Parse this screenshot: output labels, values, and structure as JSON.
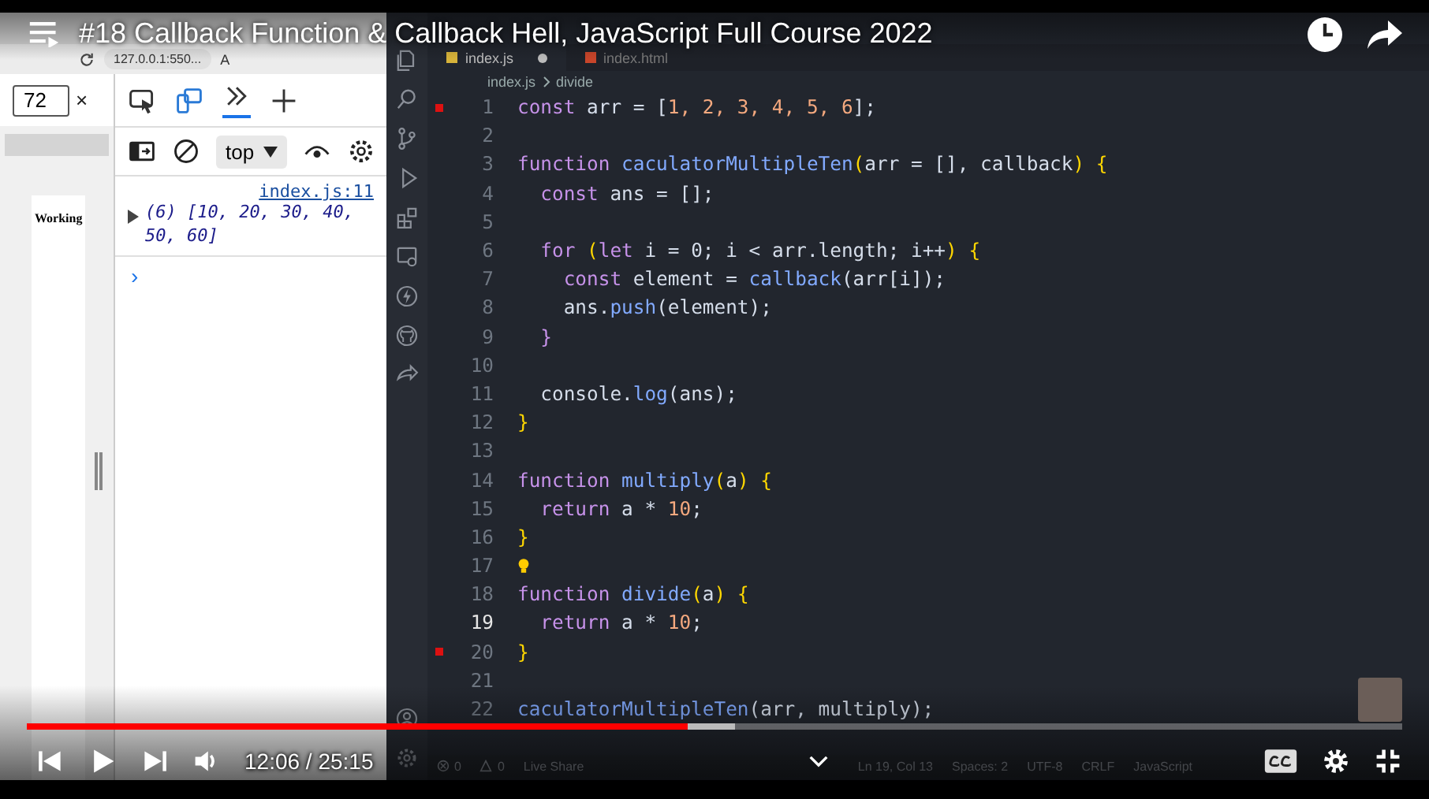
{
  "video": {
    "title": "#18 Callback Function & Callback Hell, JavaScript Full Course 2022",
    "time": "12:06 / 25:15",
    "progress": {
      "level": 0.48
    },
    "buffered": {
      "level": 0.515
    }
  },
  "browser": {
    "address": "127.0.0.1:550...",
    "reader": "A",
    "zoom_field": {
      "value": "72"
    },
    "close": "×",
    "page_text": "Working",
    "console": {
      "context": "top",
      "source": "index.js:11",
      "output": "(6) [10, 20, 30, 40, 50, 60]",
      "prompt": "›"
    }
  },
  "editor": {
    "tabs": [
      {
        "label": "index.js",
        "selected": true,
        "modified": true
      },
      {
        "label": "index.html",
        "selected": false,
        "modified": false
      }
    ],
    "breadcrumb": [
      "index.js",
      "divide"
    ],
    "lines": [
      {
        "number": "1",
        "breakpoint": true,
        "current": false,
        "hint": false,
        "tokens": [
          {
            "kind": "keyword",
            "text": "const"
          },
          {
            "kind": "variable",
            "text": " arr = ["
          },
          {
            "kind": "number",
            "text": "1, 2, 3, 4, 5, 6"
          },
          {
            "kind": "punct",
            "text": "];"
          }
        ]
      },
      {
        "number": "2",
        "breakpoint": false,
        "current": false,
        "hint": false
      },
      {
        "number": "3",
        "breakpoint": false,
        "current": false,
        "hint": false,
        "tokens": [
          {
            "kind": "keyword",
            "text": "function"
          },
          {
            "kind": "function",
            "text": " caculatorMultipleTen"
          },
          {
            "kind": "bracket",
            "text": "("
          },
          {
            "kind": "variable",
            "text": "arr = [], callback"
          },
          {
            "kind": "bracket",
            "text": ") {"
          }
        ]
      },
      {
        "number": "4",
        "breakpoint": false,
        "current": false,
        "hint": false,
        "tokens": [
          {
            "kind": "keyword",
            "text": "  const"
          },
          {
            "kind": "variable",
            "text": " ans = [];"
          }
        ]
      },
      {
        "number": "5",
        "breakpoint": false,
        "current": false,
        "hint": false
      },
      {
        "number": "6",
        "breakpoint": false,
        "current": false,
        "hint": false,
        "tokens": [
          {
            "kind": "keyword",
            "text": "  for"
          },
          {
            "kind": "bracket",
            "text": " ("
          },
          {
            "kind": "keyword",
            "text": "let"
          },
          {
            "kind": "variable",
            "text": " i = 0; i < arr.length; i++"
          },
          {
            "kind": "bracket",
            "text": ") {"
          }
        ]
      },
      {
        "number": "7",
        "breakpoint": false,
        "current": false,
        "hint": false,
        "tokens": [
          {
            "kind": "keyword",
            "text": "    const"
          },
          {
            "kind": "variable",
            "text": " element = "
          },
          {
            "kind": "function",
            "text": "callback"
          },
          {
            "kind": "variable",
            "text": "(arr[i]);"
          }
        ]
      },
      {
        "number": "8",
        "breakpoint": false,
        "current": false,
        "hint": false,
        "tokens": [
          {
            "kind": "variable",
            "text": "    ans."
          },
          {
            "kind": "function",
            "text": "push"
          },
          {
            "kind": "variable",
            "text": "(element);"
          }
        ]
      },
      {
        "number": "9",
        "breakpoint": false,
        "current": false,
        "hint": false,
        "tokens": [
          {
            "kind": "keyword",
            "text": "  }"
          }
        ]
      },
      {
        "number": "10",
        "breakpoint": false,
        "current": false,
        "hint": false
      },
      {
        "number": "11",
        "breakpoint": false,
        "current": false,
        "hint": false,
        "tokens": [
          {
            "kind": "variable",
            "text": "  console."
          },
          {
            "kind": "function",
            "text": "log"
          },
          {
            "kind": "variable",
            "text": "(ans);"
          }
        ]
      },
      {
        "number": "12",
        "breakpoint": false,
        "current": false,
        "hint": false,
        "tokens": [
          {
            "kind": "bracket",
            "text": "}"
          }
        ]
      },
      {
        "number": "13",
        "breakpoint": false,
        "current": false,
        "hint": false
      },
      {
        "number": "14",
        "breakpoint": false,
        "current": false,
        "hint": false,
        "tokens": [
          {
            "kind": "keyword",
            "text": "function"
          },
          {
            "kind": "function",
            "text": " multiply"
          },
          {
            "kind": "bracket",
            "text": "("
          },
          {
            "kind": "variable",
            "text": "a"
          },
          {
            "kind": "bracket",
            "text": ") {"
          }
        ]
      },
      {
        "number": "15",
        "breakpoint": false,
        "current": false,
        "hint": false,
        "tokens": [
          {
            "kind": "keyword",
            "text": "  return"
          },
          {
            "kind": "variable",
            "text": " a * "
          },
          {
            "kind": "number",
            "text": "10"
          },
          {
            "kind": "punct",
            "text": ";"
          }
        ]
      },
      {
        "number": "16",
        "breakpoint": false,
        "current": false,
        "hint": false,
        "tokens": [
          {
            "kind": "bracket",
            "text": "}"
          }
        ]
      },
      {
        "number": "17",
        "breakpoint": false,
        "current": false,
        "hint": true
      },
      {
        "number": "18",
        "breakpoint": false,
        "current": false,
        "hint": false,
        "tokens": [
          {
            "kind": "keyword",
            "text": "function"
          },
          {
            "kind": "function",
            "text": " divide"
          },
          {
            "kind": "bracket",
            "text": "("
          },
          {
            "kind": "variable",
            "text": "a"
          },
          {
            "kind": "bracket",
            "text": ") {"
          }
        ]
      },
      {
        "number": "19",
        "breakpoint": false,
        "current": true,
        "hint": false,
        "tokens": [
          {
            "kind": "keyword",
            "text": "  return"
          },
          {
            "kind": "variable",
            "text": " a * "
          },
          {
            "kind": "number",
            "text": "10"
          },
          {
            "kind": "punct",
            "text": ";"
          }
        ]
      },
      {
        "number": "20",
        "breakpoint": true,
        "current": false,
        "hint": false,
        "tokens": [
          {
            "kind": "bracket",
            "text": "}"
          }
        ]
      },
      {
        "number": "21",
        "breakpoint": false,
        "current": false,
        "hint": false
      },
      {
        "number": "22",
        "breakpoint": false,
        "current": false,
        "hint": false,
        "tokens": [
          {
            "kind": "function",
            "text": "caculatorMultipleTen"
          },
          {
            "kind": "variable",
            "text": "(arr, multiply);"
          }
        ]
      }
    ],
    "status": {
      "errors": "0",
      "warnings": "0",
      "live_share": "Live Share",
      "position": "Ln 19, Col 13",
      "spaces": "Spaces: 2",
      "encoding": "UTF-8",
      "eol": "CRLF",
      "language": "JavaScript"
    }
  }
}
